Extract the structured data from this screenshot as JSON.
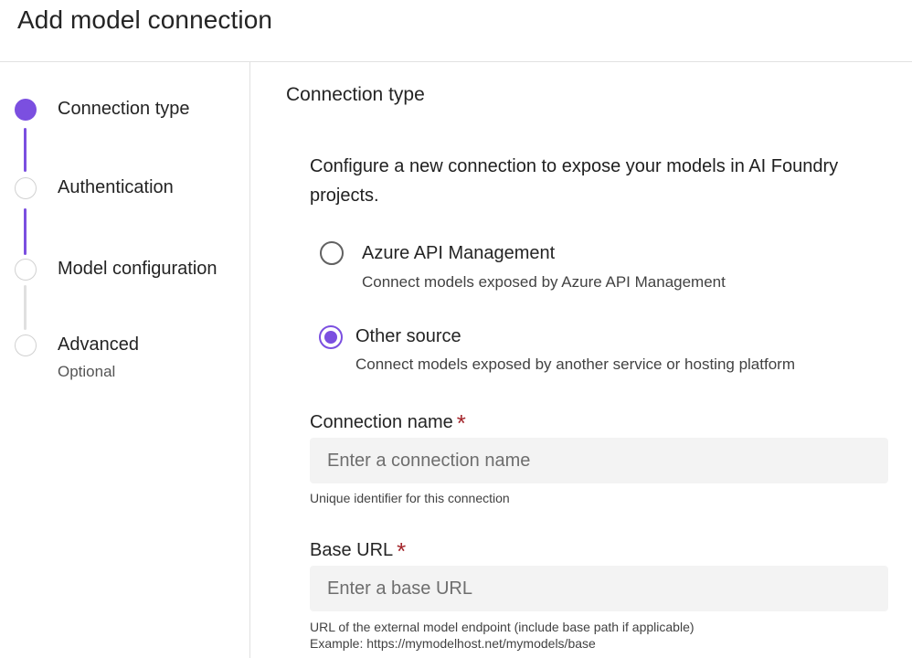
{
  "page": {
    "title": "Add model connection"
  },
  "stepper": {
    "steps": [
      {
        "label": "Connection type",
        "sub": "",
        "state": "active"
      },
      {
        "label": "Authentication",
        "sub": "",
        "state": "inactive"
      },
      {
        "label": "Model configuration",
        "sub": "",
        "state": "inactive"
      },
      {
        "label": "Advanced",
        "sub": "Optional",
        "state": "inactive"
      }
    ]
  },
  "main": {
    "section_title": "Connection type",
    "intro": "Configure a new connection to expose your models in AI Foundry projects.",
    "options": [
      {
        "label": "Azure API Management",
        "description": "Connect models exposed by Azure API Management",
        "checked": false
      },
      {
        "label": "Other source",
        "description": "Connect models exposed by another service or hosting platform",
        "checked": true
      }
    ],
    "fields": {
      "connection_name": {
        "label": "Connection name",
        "required_mark": "*",
        "value": "",
        "placeholder": "Enter a connection name",
        "hint": "Unique identifier for this connection"
      },
      "base_url": {
        "label": "Base URL",
        "required_mark": "*",
        "value": "",
        "placeholder": "Enter a base URL",
        "hint_line1": "URL of the external model endpoint (include base path if applicable)",
        "hint_line2": "Example: https://mymodelhost.net/mymodels/base"
      }
    }
  },
  "colors": {
    "accent": "#7b4fe0",
    "required": "#a4262c",
    "input_bg": "#f3f3f3",
    "divider": "#e1e1e1"
  }
}
